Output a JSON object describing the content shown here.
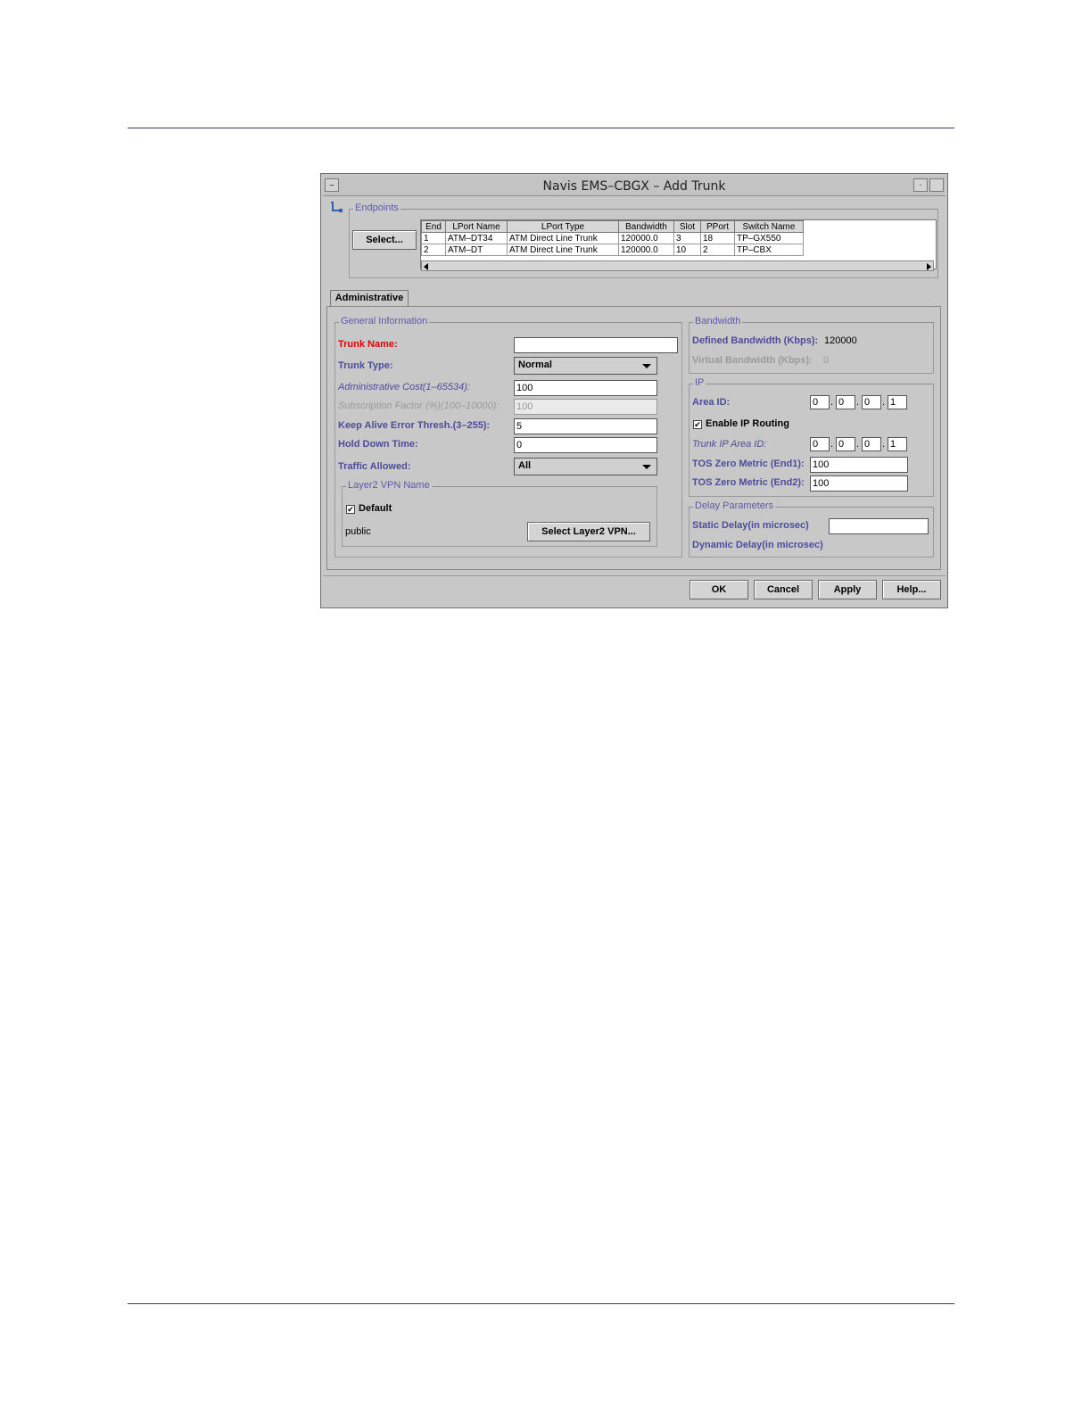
{
  "window": {
    "title": "Navis EMS–CBGX – Add Trunk",
    "minimize_glyph": "–",
    "menu_glyph": "·"
  },
  "endpoints": {
    "legend": "Endpoints",
    "select_button": "Select...",
    "columns": [
      "End",
      "LPort Name",
      "LPort Type",
      "Bandwidth",
      "Slot",
      "PPort",
      "Switch Name"
    ],
    "rows": [
      [
        "1",
        "ATM–DT34",
        "ATM Direct Line Trunk",
        "120000.0",
        "3",
        "18",
        "TP–GX550"
      ],
      [
        "2",
        "ATM–DT",
        "ATM Direct Line Trunk",
        "120000.0",
        "10",
        "2",
        "TP–CBX"
      ]
    ]
  },
  "tabs": {
    "administrative": "Administrative"
  },
  "general": {
    "legend": "General Information",
    "trunk_name_label": "Trunk Name:",
    "trunk_name_value": "",
    "trunk_type_label": "Trunk Type:",
    "trunk_type_value": "Normal",
    "admin_cost_label": "Administrative Cost(1–65534):",
    "admin_cost_value": "100",
    "subscription_label": "Subscription Factor (%)(100–10000):",
    "subscription_value": "100",
    "keepalive_label": "Keep Alive Error Thresh.(3–255):",
    "keepalive_value": "5",
    "holddown_label": "Hold Down Time:",
    "holddown_value": "0",
    "traffic_label": "Traffic Allowed:",
    "traffic_value": "All"
  },
  "layer2": {
    "legend": "Layer2 VPN Name",
    "default_label": "Default",
    "default_checked": true,
    "vpn_name": "public",
    "select_button": "Select Layer2 VPN..."
  },
  "bandwidth": {
    "legend": "Bandwidth",
    "defined_label": "Defined Bandwidth (Kbps):",
    "defined_value": "120000",
    "virtual_label": "Virtual Bandwidth (Kbps):",
    "virtual_value": "0"
  },
  "ip": {
    "legend": "IP",
    "area_id_label": "Area ID:",
    "area_id": [
      "0",
      "0",
      "0",
      "1"
    ],
    "enable_routing_label": "Enable IP Routing",
    "enable_routing_checked": true,
    "trunk_area_label": "Trunk IP Area ID:",
    "trunk_area_id": [
      "0",
      "0",
      "0",
      "1"
    ],
    "tos_end1_label": "TOS Zero Metric (End1):",
    "tos_end1_value": "100",
    "tos_end2_label": "TOS Zero Metric (End2):",
    "tos_end2_value": "100"
  },
  "delay": {
    "legend": "Delay Parameters",
    "static_label": "Static Delay(in microsec)",
    "static_value": "",
    "dynamic_label": "Dynamic Delay(in microsec)"
  },
  "footer": {
    "ok": "OK",
    "cancel": "Cancel",
    "apply": "Apply",
    "help": "Help..."
  }
}
